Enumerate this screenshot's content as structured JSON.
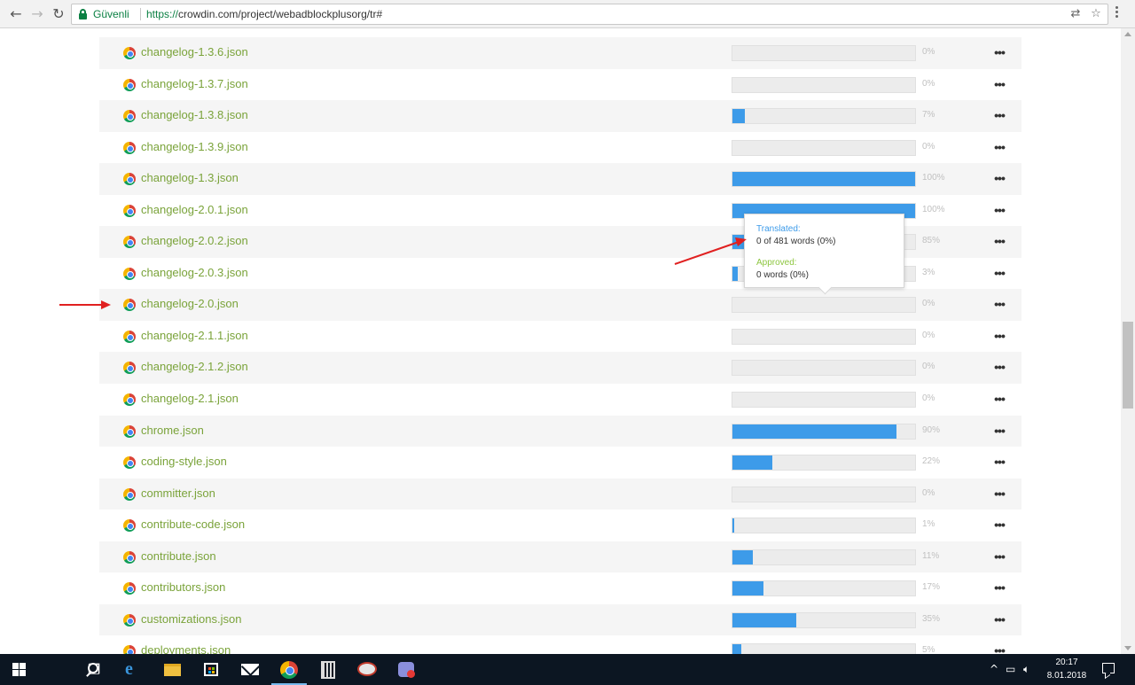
{
  "browser": {
    "back_icon": "arrow-left-icon",
    "forward_icon": "arrow-right-icon",
    "reload_icon": "reload-icon",
    "secure_label": "Güvenli",
    "url_scheme": "https://",
    "url_rest": "crowdin.com/project/webadblockplusorg/tr#",
    "translate_icon": "translate-icon",
    "bookmark_icon": "star-icon"
  },
  "files": [
    {
      "name": "changelog-1.3.6.json",
      "progress": 0,
      "percent": "0%"
    },
    {
      "name": "changelog-1.3.7.json",
      "progress": 0,
      "percent": "0%"
    },
    {
      "name": "changelog-1.3.8.json",
      "progress": 7,
      "percent": "7%"
    },
    {
      "name": "changelog-1.3.9.json",
      "progress": 0,
      "percent": "0%"
    },
    {
      "name": "changelog-1.3.json",
      "progress": 100,
      "percent": "100%"
    },
    {
      "name": "changelog-2.0.1.json",
      "progress": 100,
      "percent": "100%"
    },
    {
      "name": "changelog-2.0.2.json",
      "progress": 85,
      "percent": "85%"
    },
    {
      "name": "changelog-2.0.3.json",
      "progress": 3,
      "percent": "3%"
    },
    {
      "name": "changelog-2.0.json",
      "progress": 0,
      "percent": "0%"
    },
    {
      "name": "changelog-2.1.1.json",
      "progress": 0,
      "percent": "0%"
    },
    {
      "name": "changelog-2.1.2.json",
      "progress": 0,
      "percent": "0%"
    },
    {
      "name": "changelog-2.1.json",
      "progress": 0,
      "percent": "0%"
    },
    {
      "name": "chrome.json",
      "progress": 90,
      "percent": "90%"
    },
    {
      "name": "coding-style.json",
      "progress": 22,
      "percent": "22%"
    },
    {
      "name": "committer.json",
      "progress": 0,
      "percent": "0%"
    },
    {
      "name": "contribute-code.json",
      "progress": 1,
      "percent": "1%"
    },
    {
      "name": "contribute.json",
      "progress": 11,
      "percent": "11%"
    },
    {
      "name": "contributors.json",
      "progress": 17,
      "percent": "17%"
    },
    {
      "name": "customizations.json",
      "progress": 35,
      "percent": "35%"
    },
    {
      "name": "deployments.json",
      "progress": 5,
      "percent": "5%"
    }
  ],
  "tooltip": {
    "translated_label": "Translated:",
    "translated_value": "0 of 481 words (0%)",
    "approved_label": "Approved:",
    "approved_value": "0 words (0%)"
  },
  "colors": {
    "progress_fill": "#3d9be9",
    "file_name": "#7aa33a",
    "annotation_arrow": "#e02020"
  },
  "taskbar": {
    "items": [
      "windows-start-icon",
      "search-icon",
      "task-view-icon",
      "edge-icon",
      "file-explorer-icon",
      "store-icon",
      "mail-icon",
      "chrome-icon",
      "calculator-icon",
      "snipping-tool-icon",
      "vpn-app-icon"
    ],
    "time": "20:17",
    "date": "8.01.2018"
  }
}
